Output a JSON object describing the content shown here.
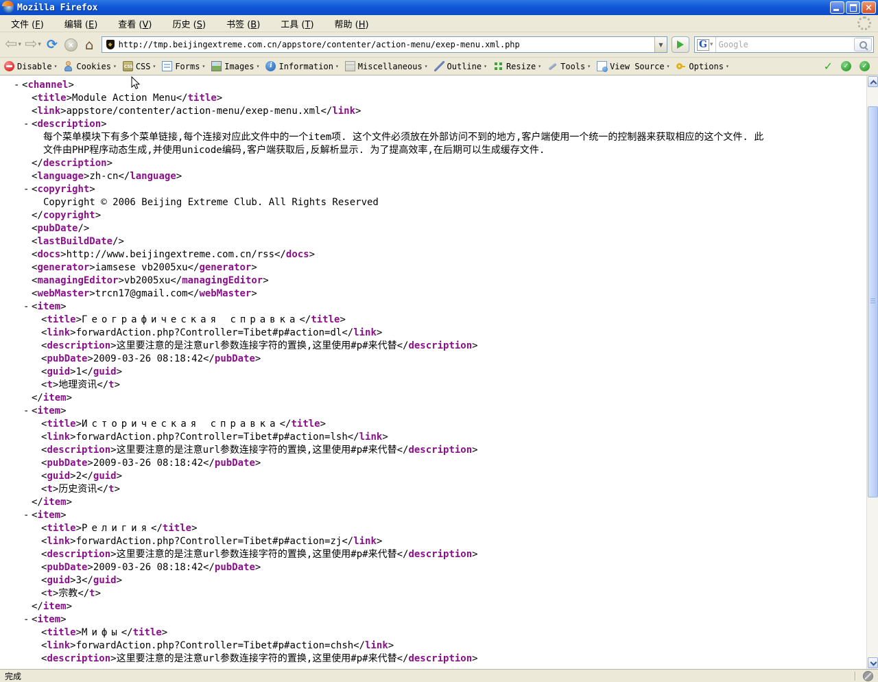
{
  "window": {
    "title": "Mozilla Firefox"
  },
  "titlebar": {
    "buttons": [
      "minimize",
      "restore",
      "close"
    ]
  },
  "menubar": {
    "items": [
      {
        "label": "文件",
        "accel": "F"
      },
      {
        "label": "编辑",
        "accel": "E"
      },
      {
        "label": "查看",
        "accel": "V"
      },
      {
        "label": "历史",
        "accel": "S"
      },
      {
        "label": "书签",
        "accel": "B"
      },
      {
        "label": "工具",
        "accel": "T"
      },
      {
        "label": "帮助",
        "accel": "H"
      }
    ]
  },
  "navbar": {
    "url": "http://tmp.beijingextreme.com.cn/appstore/contenter/action-menu/exep-menu.xml.php",
    "search_placeholder": "Google",
    "search_engine_letter": "G"
  },
  "devtoolbar": {
    "items": [
      {
        "label": "Disable",
        "icon": "disable-icon"
      },
      {
        "label": "Cookies",
        "icon": "cookies-icon"
      },
      {
        "label": "CSS",
        "icon": "css-icon"
      },
      {
        "label": "Forms",
        "icon": "forms-icon"
      },
      {
        "label": "Images",
        "icon": "images-icon"
      },
      {
        "label": "Information",
        "icon": "information-icon"
      },
      {
        "label": "Miscellaneous",
        "icon": "miscellaneous-icon"
      },
      {
        "label": "Outline",
        "icon": "outline-icon"
      },
      {
        "label": "Resize",
        "icon": "resize-icon"
      },
      {
        "label": "Tools",
        "icon": "tools-icon"
      },
      {
        "label": "View Source",
        "icon": "view-source-icon"
      },
      {
        "label": "Options",
        "icon": "options-icon"
      }
    ],
    "status_icons": [
      "check-icon",
      "circle-check-icon",
      "circle-check-icon"
    ]
  },
  "icons": {
    "dropdown_caret": "▾",
    "back": "⇦",
    "forward": "⇨",
    "reload": "⟳",
    "stop": "×",
    "home": "⌂",
    "check": "✓",
    "collapse_marker": "-"
  },
  "colors": {
    "tag_name": "#8b0f8b",
    "titlebar_blue": "#1157d6",
    "toolbar_background": "#ece9d8",
    "go_arrow_green": "#3fae3f",
    "check_green": "#2fae2f"
  },
  "statusbar": {
    "text": "完成"
  },
  "xml": {
    "lines": [
      {
        "marker": true,
        "level": 0,
        "segments": [
          [
            "open",
            "channel"
          ]
        ]
      },
      {
        "level": 1,
        "segments": [
          [
            "open",
            "title"
          ],
          [
            "text",
            "Module Action Menu"
          ],
          [
            "close",
            "title"
          ]
        ]
      },
      {
        "level": 1,
        "segments": [
          [
            "open",
            "link"
          ],
          [
            "text",
            "appstore/contenter/action-menu/exep-menu.xml"
          ],
          [
            "close",
            "link"
          ]
        ]
      },
      {
        "marker": true,
        "level": 1,
        "segments": [
          [
            "open",
            "description"
          ]
        ]
      },
      {
        "level": 2,
        "text_line": true,
        "segments": [
          [
            "text",
            "每个菜单模块下有多个菜单链接,每个连接对应此文件中的一个item项. 这个文件必须放在外部访问不到的地方,客户端使用一个统一的控制器来获取相应的这个文件. 此"
          ]
        ]
      },
      {
        "level": 2,
        "text_line": true,
        "segments": [
          [
            "text",
            "文件由PHP程序动态生成,并使用unicode编码,客户端获取后,反解析显示. 为了提高效率,在后期可以生成缓存文件."
          ]
        ]
      },
      {
        "level": 1,
        "segments": [
          [
            "close",
            "description"
          ]
        ]
      },
      {
        "level": 1,
        "segments": [
          [
            "open",
            "language"
          ],
          [
            "text",
            "zh-cn"
          ],
          [
            "close",
            "language"
          ]
        ]
      },
      {
        "marker": true,
        "level": 1,
        "segments": [
          [
            "open",
            "copyright"
          ]
        ]
      },
      {
        "level": 2,
        "text_line": true,
        "segments": [
          [
            "text",
            "Copyright © 2006 Beijing Extreme Club. All Rights Reserved"
          ]
        ]
      },
      {
        "level": 1,
        "segments": [
          [
            "close",
            "copyright"
          ]
        ]
      },
      {
        "level": 1,
        "segments": [
          [
            "self",
            "pubDate"
          ]
        ]
      },
      {
        "level": 1,
        "segments": [
          [
            "self",
            "lastBuildDate"
          ]
        ]
      },
      {
        "level": 1,
        "segments": [
          [
            "open",
            "docs"
          ],
          [
            "text",
            "http://www.beijingextreme.com.cn/rss"
          ],
          [
            "close",
            "docs"
          ]
        ]
      },
      {
        "level": 1,
        "segments": [
          [
            "open",
            "generator"
          ],
          [
            "text",
            "iamsese vb2005xu"
          ],
          [
            "close",
            "generator"
          ]
        ]
      },
      {
        "level": 1,
        "segments": [
          [
            "open",
            "managingEditor"
          ],
          [
            "text",
            "vb2005xu"
          ],
          [
            "close",
            "managingEditor"
          ]
        ]
      },
      {
        "level": 1,
        "segments": [
          [
            "open",
            "webMaster"
          ],
          [
            "text",
            "trcn17@gmail.com"
          ],
          [
            "close",
            "webMaster"
          ]
        ]
      },
      {
        "marker": true,
        "level": 1,
        "segments": [
          [
            "open",
            "item"
          ]
        ]
      },
      {
        "level": 2,
        "segments": [
          [
            "open",
            "title"
          ],
          [
            "text_wide",
            "Географическая справка"
          ],
          [
            "close",
            "title"
          ]
        ]
      },
      {
        "level": 2,
        "segments": [
          [
            "open",
            "link"
          ],
          [
            "text",
            "forwardAction.php?Controller=Tibet#p#action=dl"
          ],
          [
            "close",
            "link"
          ]
        ]
      },
      {
        "level": 2,
        "segments": [
          [
            "open",
            "description"
          ],
          [
            "text",
            "这里要注意的是注意url参数连接字符的置换,这里使用#p#来代替"
          ],
          [
            "close",
            "description"
          ]
        ]
      },
      {
        "level": 2,
        "segments": [
          [
            "open",
            "pubDate"
          ],
          [
            "text",
            "2009-03-26 08:18:42"
          ],
          [
            "close",
            "pubDate"
          ]
        ]
      },
      {
        "level": 2,
        "segments": [
          [
            "open",
            "guid"
          ],
          [
            "text",
            "1"
          ],
          [
            "close",
            "guid"
          ]
        ]
      },
      {
        "level": 2,
        "segments": [
          [
            "open",
            "t"
          ],
          [
            "text",
            "地理资讯"
          ],
          [
            "close",
            "t"
          ]
        ]
      },
      {
        "level": 1,
        "segments": [
          [
            "close",
            "item"
          ]
        ]
      },
      {
        "marker": true,
        "level": 1,
        "segments": [
          [
            "open",
            "item"
          ]
        ]
      },
      {
        "level": 2,
        "segments": [
          [
            "open",
            "title"
          ],
          [
            "text_wide",
            "Историческая справка"
          ],
          [
            "close",
            "title"
          ]
        ]
      },
      {
        "level": 2,
        "segments": [
          [
            "open",
            "link"
          ],
          [
            "text",
            "forwardAction.php?Controller=Tibet#p#action=lsh"
          ],
          [
            "close",
            "link"
          ]
        ]
      },
      {
        "level": 2,
        "segments": [
          [
            "open",
            "description"
          ],
          [
            "text",
            "这里要注意的是注意url参数连接字符的置换,这里使用#p#来代替"
          ],
          [
            "close",
            "description"
          ]
        ]
      },
      {
        "level": 2,
        "segments": [
          [
            "open",
            "pubDate"
          ],
          [
            "text",
            "2009-03-26 08:18:42"
          ],
          [
            "close",
            "pubDate"
          ]
        ]
      },
      {
        "level": 2,
        "segments": [
          [
            "open",
            "guid"
          ],
          [
            "text",
            "2"
          ],
          [
            "close",
            "guid"
          ]
        ]
      },
      {
        "level": 2,
        "segments": [
          [
            "open",
            "t"
          ],
          [
            "text",
            "历史资讯"
          ],
          [
            "close",
            "t"
          ]
        ]
      },
      {
        "level": 1,
        "segments": [
          [
            "close",
            "item"
          ]
        ]
      },
      {
        "marker": true,
        "level": 1,
        "segments": [
          [
            "open",
            "item"
          ]
        ]
      },
      {
        "level": 2,
        "segments": [
          [
            "open",
            "title"
          ],
          [
            "text_wide",
            "Религия"
          ],
          [
            "close",
            "title"
          ]
        ]
      },
      {
        "level": 2,
        "segments": [
          [
            "open",
            "link"
          ],
          [
            "text",
            "forwardAction.php?Controller=Tibet#p#action=zj"
          ],
          [
            "close",
            "link"
          ]
        ]
      },
      {
        "level": 2,
        "segments": [
          [
            "open",
            "description"
          ],
          [
            "text",
            "这里要注意的是注意url参数连接字符的置换,这里使用#p#来代替"
          ],
          [
            "close",
            "description"
          ]
        ]
      },
      {
        "level": 2,
        "segments": [
          [
            "open",
            "pubDate"
          ],
          [
            "text",
            "2009-03-26 08:18:42"
          ],
          [
            "close",
            "pubDate"
          ]
        ]
      },
      {
        "level": 2,
        "segments": [
          [
            "open",
            "guid"
          ],
          [
            "text",
            "3"
          ],
          [
            "close",
            "guid"
          ]
        ]
      },
      {
        "level": 2,
        "segments": [
          [
            "open",
            "t"
          ],
          [
            "text",
            "宗教"
          ],
          [
            "close",
            "t"
          ]
        ]
      },
      {
        "level": 1,
        "segments": [
          [
            "close",
            "item"
          ]
        ]
      },
      {
        "marker": true,
        "level": 1,
        "segments": [
          [
            "open",
            "item"
          ]
        ]
      },
      {
        "level": 2,
        "segments": [
          [
            "open",
            "title"
          ],
          [
            "text_wide",
            "Мифы"
          ],
          [
            "close",
            "title"
          ]
        ]
      },
      {
        "level": 2,
        "segments": [
          [
            "open",
            "link"
          ],
          [
            "text",
            "forwardAction.php?Controller=Tibet#p#action=chsh"
          ],
          [
            "close",
            "link"
          ]
        ]
      },
      {
        "level": 2,
        "segments": [
          [
            "open",
            "description"
          ],
          [
            "text",
            "这里要注意的是注意url参数连接字符的置换,这里使用#p#来代替"
          ],
          [
            "close",
            "description"
          ]
        ]
      }
    ]
  }
}
